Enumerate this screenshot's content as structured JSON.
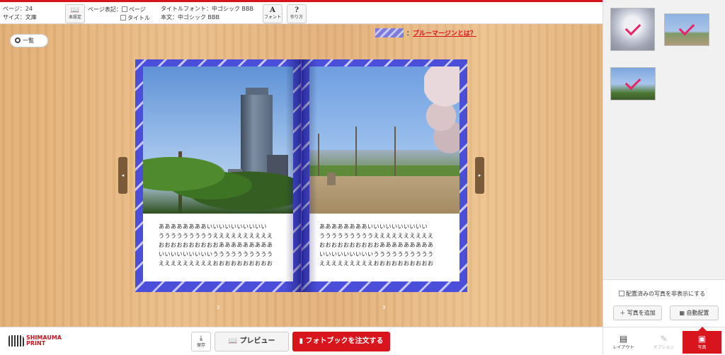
{
  "toolbar": {
    "page_info": "ページ：24",
    "size_info": "サイズ：文庫",
    "book_settings_label": "本設定",
    "page_display_label": "ページ表記：",
    "opt_page": "ページ",
    "opt_title": "タイトル",
    "title_font": "タイトルフォント：中ゴシック BBB",
    "body_font": "本文：中ゴシック BBB",
    "font_label": "フォント",
    "howto_label": "作り方",
    "font_glyph": "A",
    "howto_glyph": "?"
  },
  "editor": {
    "list_label": "一覧",
    "margin_link": "ブルーマージンとは？",
    "margin_prefix": "：",
    "prev_arrow": "◂",
    "next_arrow": "▸",
    "left_page_num": "2",
    "right_page_num": "3",
    "left_text": [
      "ああああああああいいいいいいいいいい",
      "うううううううううええええええええええ",
      "おおおおおおおおおおあああああああああ",
      "いいいいいいいいいうううううううううう",
      "えええええええええおおおおおおおおおお"
    ],
    "right_text": [
      "ああああああああいいいいいいいいいい",
      "うううううううううええええええええええ",
      "おおおおおおおおおおあああああああああ",
      "いいいいいいいいいうううううううううう",
      "えええええええええおおおおおおおおおお"
    ]
  },
  "bottom": {
    "logo_text": "SHIMAUMA",
    "logo_sub": "PRINT",
    "save_label": "保存",
    "save_glyph": "⤓",
    "preview_label": "📖 プレビュー",
    "order_label": "▮ フォトブックを注文する"
  },
  "sidebar": {
    "hide_placed_label": "配置済みの写真を非表示にする",
    "add_photo_label": "＋ 写真を追加",
    "auto_layout_label": "▦ 自動配置",
    "tabs": [
      {
        "label": "レイアウト",
        "glyph": "▤"
      },
      {
        "label": "オプション",
        "glyph": "✎"
      },
      {
        "label": "写真",
        "glyph": "▣"
      }
    ]
  },
  "colors": {
    "accent": "#d8141c",
    "margin_blue": "#4a4ed8",
    "check_pink": "#e8246a"
  }
}
